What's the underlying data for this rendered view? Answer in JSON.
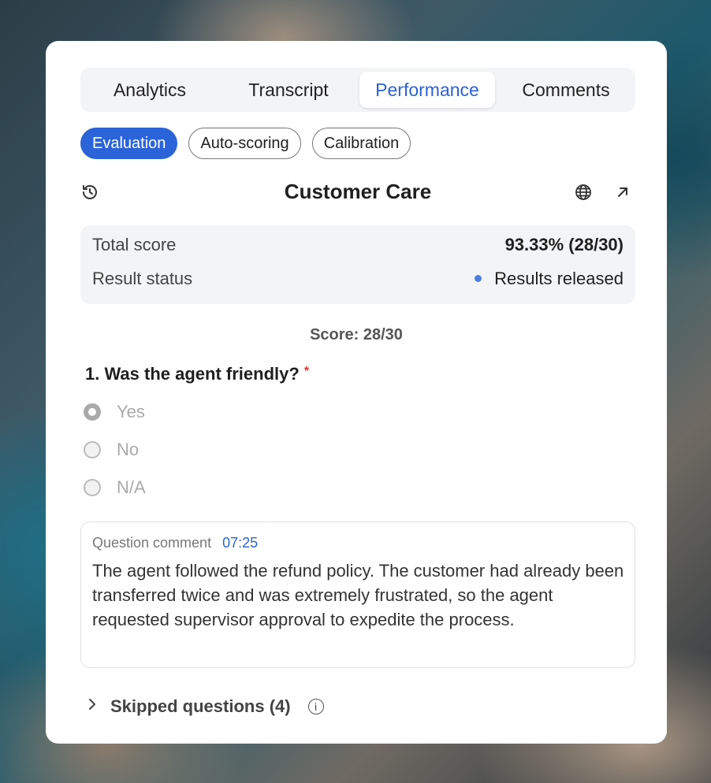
{
  "tabs": [
    {
      "label": "Analytics"
    },
    {
      "label": "Transcript"
    },
    {
      "label": "Performance",
      "active": true
    },
    {
      "label": "Comments"
    }
  ],
  "subtabs": [
    {
      "label": "Evaluation",
      "active": true
    },
    {
      "label": "Auto-scoring"
    },
    {
      "label": "Calibration"
    }
  ],
  "header": {
    "title": "Customer Care",
    "icons": [
      "history-icon",
      "globe-icon",
      "external-link-icon"
    ]
  },
  "summary": {
    "total_score_label": "Total score",
    "total_score_value": "93.33% (28/30)",
    "result_status_label": "Result status",
    "result_status_value": "Results released"
  },
  "score_line": "Score: 28/30",
  "question": {
    "number": "1.",
    "text": "Was the agent friendly?",
    "required_mark": "*",
    "options": [
      {
        "label": "Yes",
        "selected": true
      },
      {
        "label": "No",
        "selected": false
      },
      {
        "label": "N/A",
        "selected": false
      }
    ]
  },
  "comment": {
    "label": "Question comment",
    "timestamp": "07:25",
    "text": "The agent followed the refund policy. The customer had already been transferred twice and was extremely frustrated, so the agent requested supervisor approval to expedite the process."
  },
  "skipped": {
    "label": "Skipped questions (4)"
  },
  "colors": {
    "accent": "#2b63d9",
    "status_dot": "#4a7fe0",
    "required": "#dd3333"
  }
}
